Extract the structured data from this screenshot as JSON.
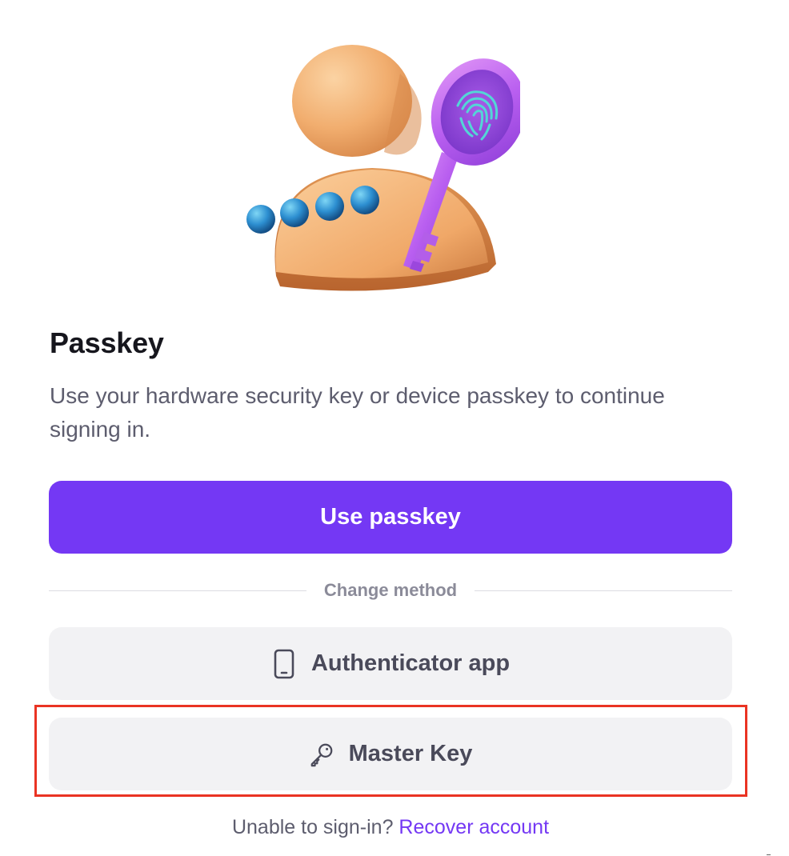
{
  "header": {
    "title": "Passkey",
    "subtitle": "Use your hardware security key or device passkey to continue signing in."
  },
  "primary_action": {
    "label": "Use passkey"
  },
  "divider": {
    "label": "Change method"
  },
  "methods": [
    {
      "label": "Authenticator app",
      "icon": "smartphone-icon"
    },
    {
      "label": "Master Key",
      "icon": "key-icon"
    }
  ],
  "footer": {
    "prompt": "Unable to sign-in?",
    "link_label": "Recover account"
  },
  "colors": {
    "accent": "#7438f4",
    "method_bg": "#f2f2f4",
    "highlight": "#ea3323"
  }
}
